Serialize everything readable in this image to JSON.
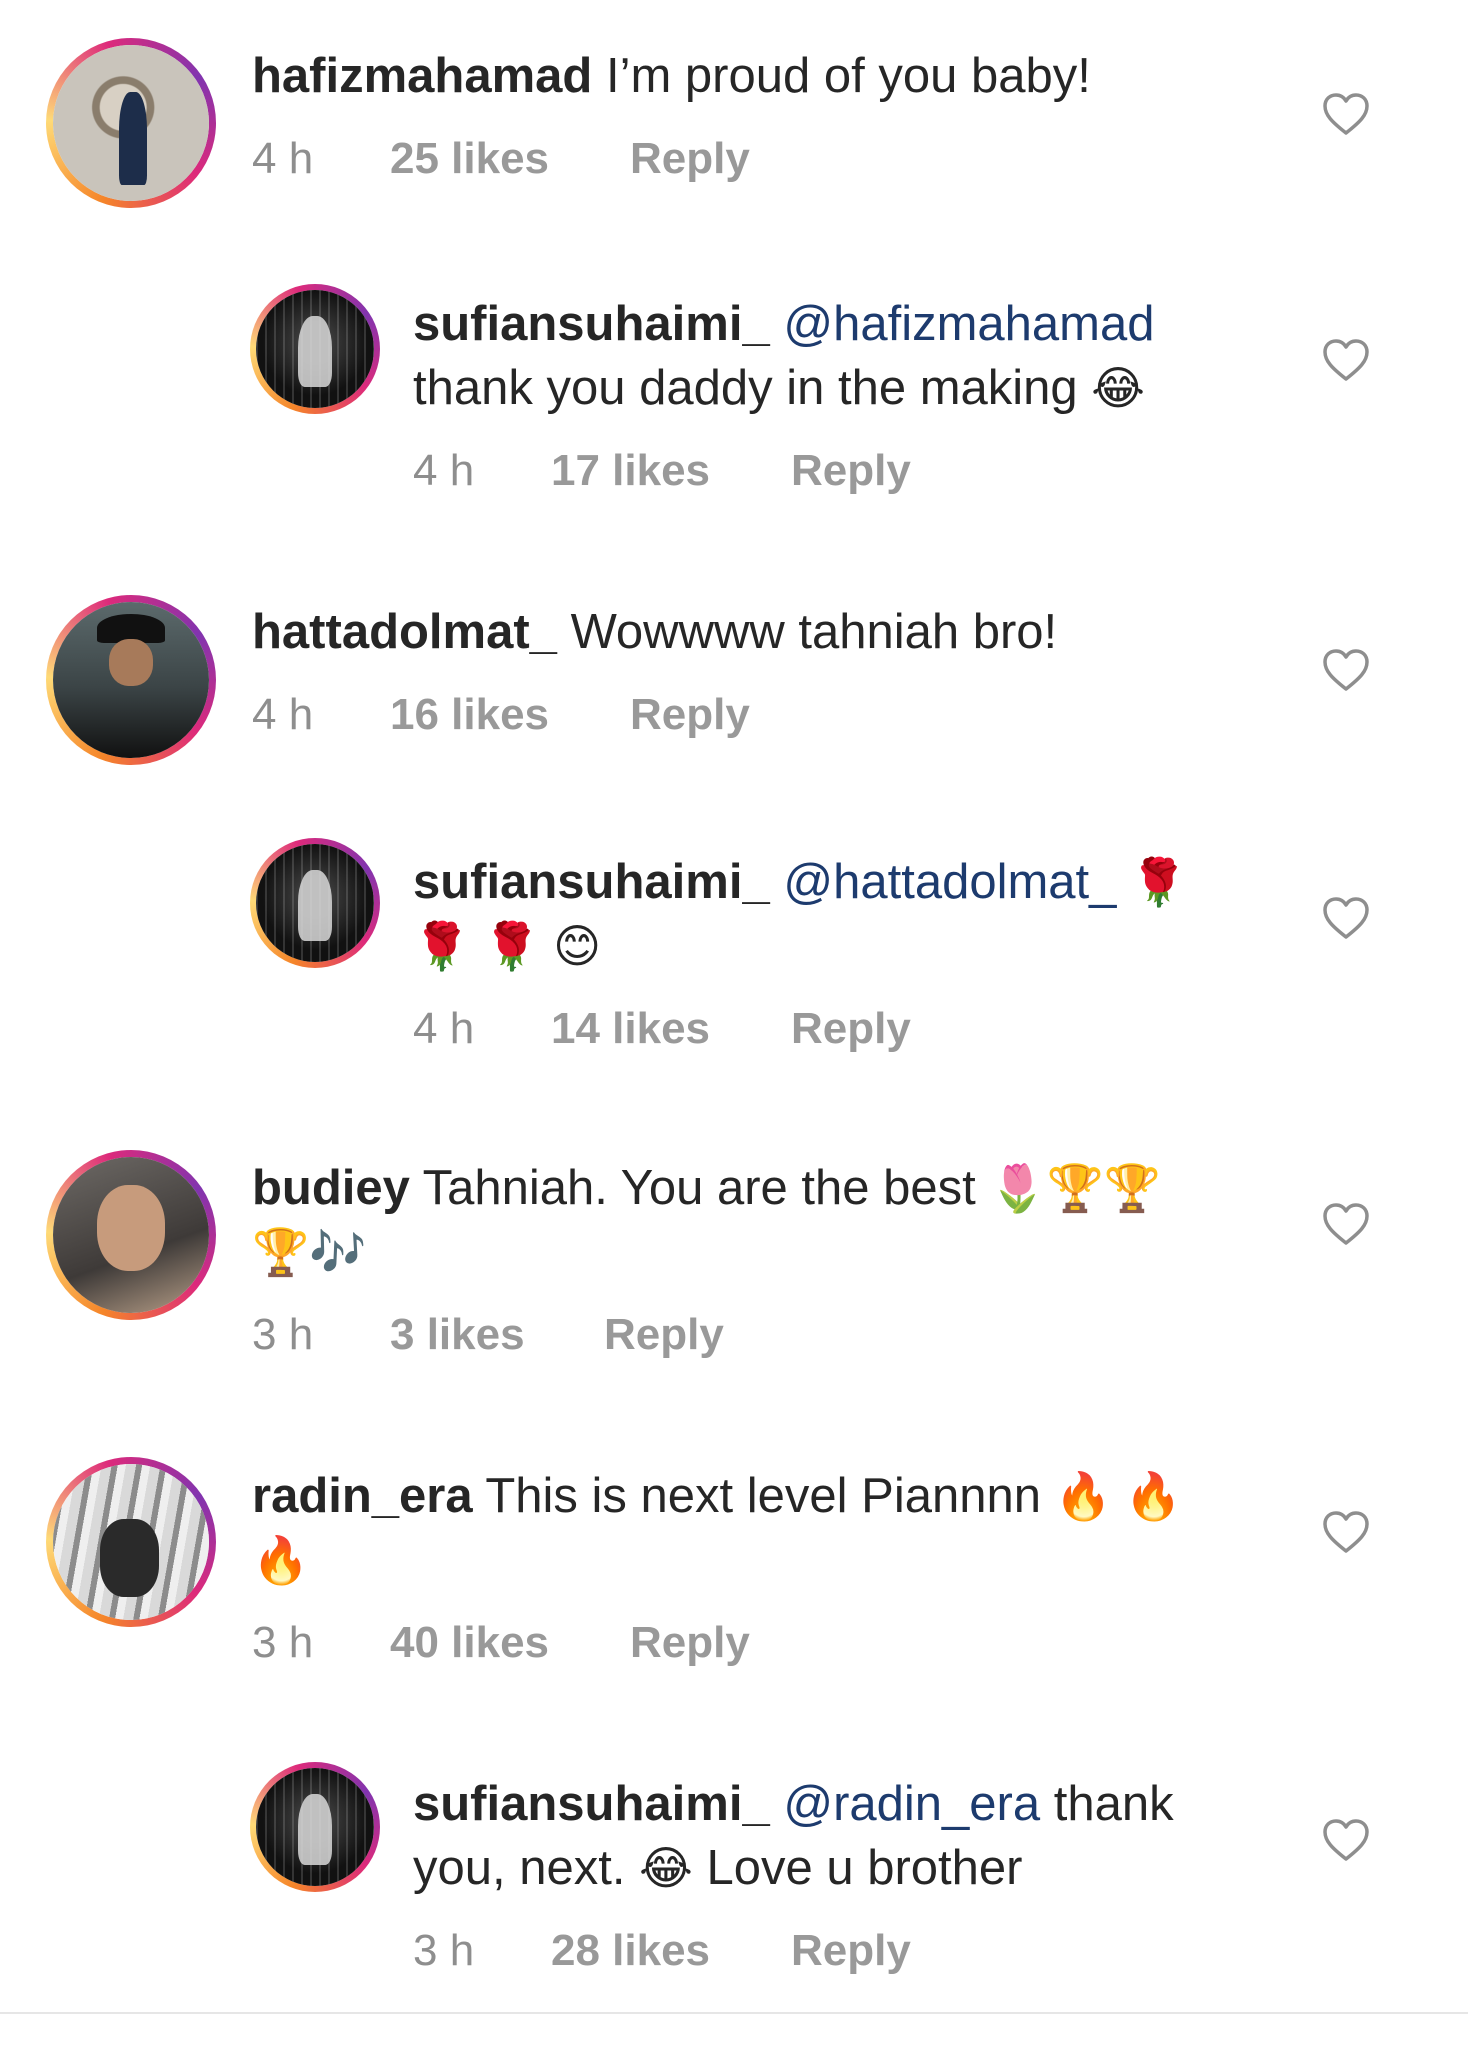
{
  "comments": [
    {
      "avatar_icon": "user-avatar",
      "username": "hafizmahamad",
      "mention": "",
      "text": "I’m proud of you baby!",
      "text2": "",
      "time": "4 h",
      "likes": "25 likes",
      "reply": "Reply"
    },
    {
      "avatar_icon": "user-avatar",
      "username": "sufiansuhaimi_",
      "mention": "@hafizmahamad",
      "text": "thank you daddy in the making",
      "emoji": "😂",
      "time": "4 h",
      "likes": "17 likes",
      "reply": "Reply"
    },
    {
      "avatar_icon": "user-avatar",
      "username": "hattadolmat_",
      "mention": "",
      "text": "Wowwww tahniah bro!",
      "time": "4 h",
      "likes": "16 likes",
      "reply": "Reply"
    },
    {
      "avatar_icon": "user-avatar",
      "username": "sufiansuhaimi_",
      "mention": "@hattadolmat_",
      "emoji_line1": "🌹",
      "emoji_line2": "🌹 🌹 😊",
      "time": "4 h",
      "likes": "14 likes",
      "reply": "Reply"
    },
    {
      "avatar_icon": "user-avatar",
      "username": "budiey",
      "text": "Tahniah. You are the best",
      "emoji_line1": "🌷🏆🏆",
      "emoji_line2": "🏆🎶",
      "time": "3 h",
      "likes": "3 likes",
      "reply": "Reply"
    },
    {
      "avatar_icon": "user-avatar",
      "username": "radin_era",
      "text": "This is next level Piannnn",
      "emoji_line1": "🔥 🔥",
      "emoji_line2": "🔥",
      "time": "3 h",
      "likes": "40 likes",
      "reply": "Reply"
    },
    {
      "avatar_icon": "user-avatar",
      "username": "sufiansuhaimi_",
      "mention": "@radin_era",
      "text": "thank",
      "text_line2_a": "you, next.",
      "emoji": "😂",
      "text_line2_b": "Love u brother",
      "time": "3 h",
      "likes": "28 likes",
      "reply": "Reply"
    }
  ],
  "icons": {
    "like": "heart-outline-icon"
  },
  "colors": {
    "mention": "#1d3b6e",
    "meta": "#8e8e8e",
    "text": "#262626"
  }
}
